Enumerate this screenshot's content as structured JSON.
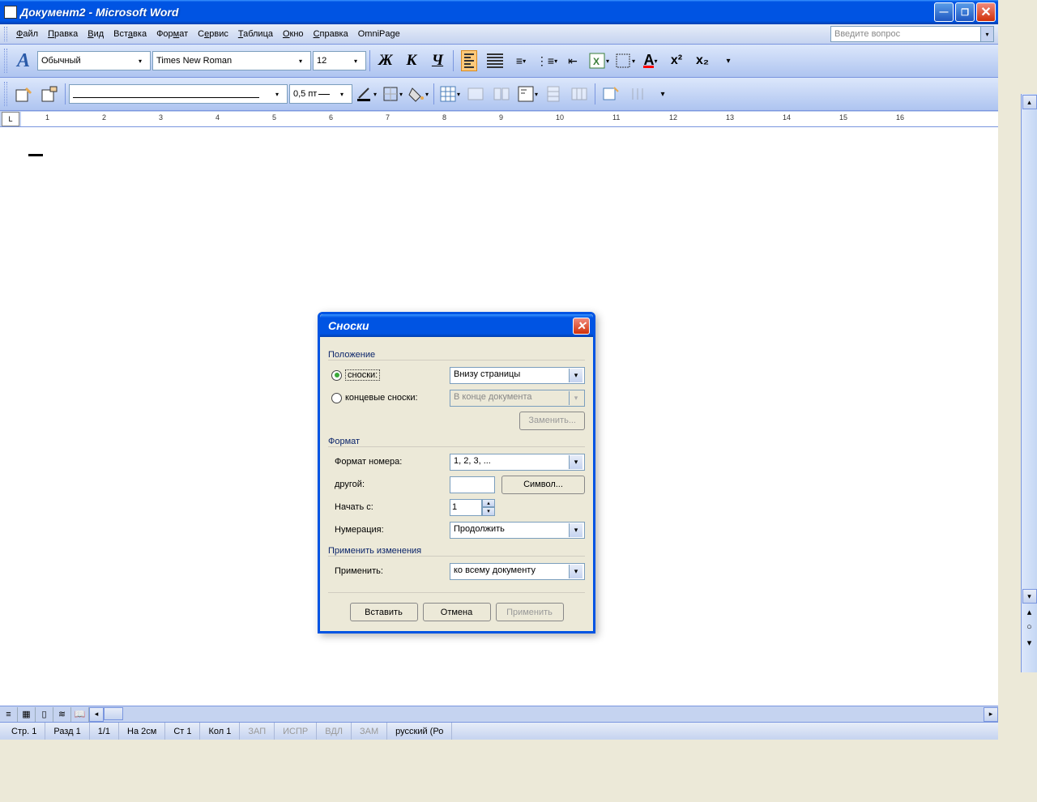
{
  "titlebar": {
    "text": "Документ2 - Microsoft Word"
  },
  "menu": {
    "file": "Файл",
    "edit": "Правка",
    "view": "Вид",
    "insert": "Вставка",
    "format": "Формат",
    "service": "Сервис",
    "table": "Таблица",
    "window": "Окно",
    "help": "Справка",
    "omnipage": "OmniPage"
  },
  "help_search_placeholder": "Введите вопрос",
  "formatting": {
    "style": "Обычный",
    "font": "Times New Roman",
    "size": "12",
    "bold": "Ж",
    "italic": "К",
    "underline": "Ч"
  },
  "toolbar2": {
    "line_weight": "0,5 пт"
  },
  "ruler_numbers": [
    "1",
    "2",
    "3",
    "4",
    "5",
    "6",
    "7",
    "8",
    "9",
    "10",
    "11",
    "12",
    "13",
    "14",
    "15",
    "16"
  ],
  "dialog": {
    "title": "Сноски",
    "section_position": "Положение",
    "footnotes_radio": "сноски:",
    "footnotes_value": "Внизу страницы",
    "endnotes_radio": "концевые сноски:",
    "endnotes_value": "В конце документа",
    "replace_btn": "Заменить...",
    "section_format": "Формат",
    "number_format_label": "Формат номера:",
    "number_format_value": "1, 2, 3, ...",
    "other_label": "другой:",
    "symbol_btn": "Символ...",
    "start_at_label": "Начать с:",
    "start_at_value": "1",
    "numbering_label": "Нумерация:",
    "numbering_value": "Продолжить",
    "section_apply": "Применить изменения",
    "apply_to_label": "Применить:",
    "apply_to_value": "ко всему документу",
    "insert_btn": "Вставить",
    "cancel_btn": "Отмена",
    "apply_btn": "Применить"
  },
  "status": {
    "page": "Стр. 1",
    "section": "Разд 1",
    "pages": "1/1",
    "at": "На 2см",
    "line": "Ст 1",
    "col": "Кол 1",
    "rec": "ЗАП",
    "trk": "ИСПР",
    "ext": "ВДЛ",
    "ovr": "ЗАМ",
    "lang": "русский (Ро"
  }
}
